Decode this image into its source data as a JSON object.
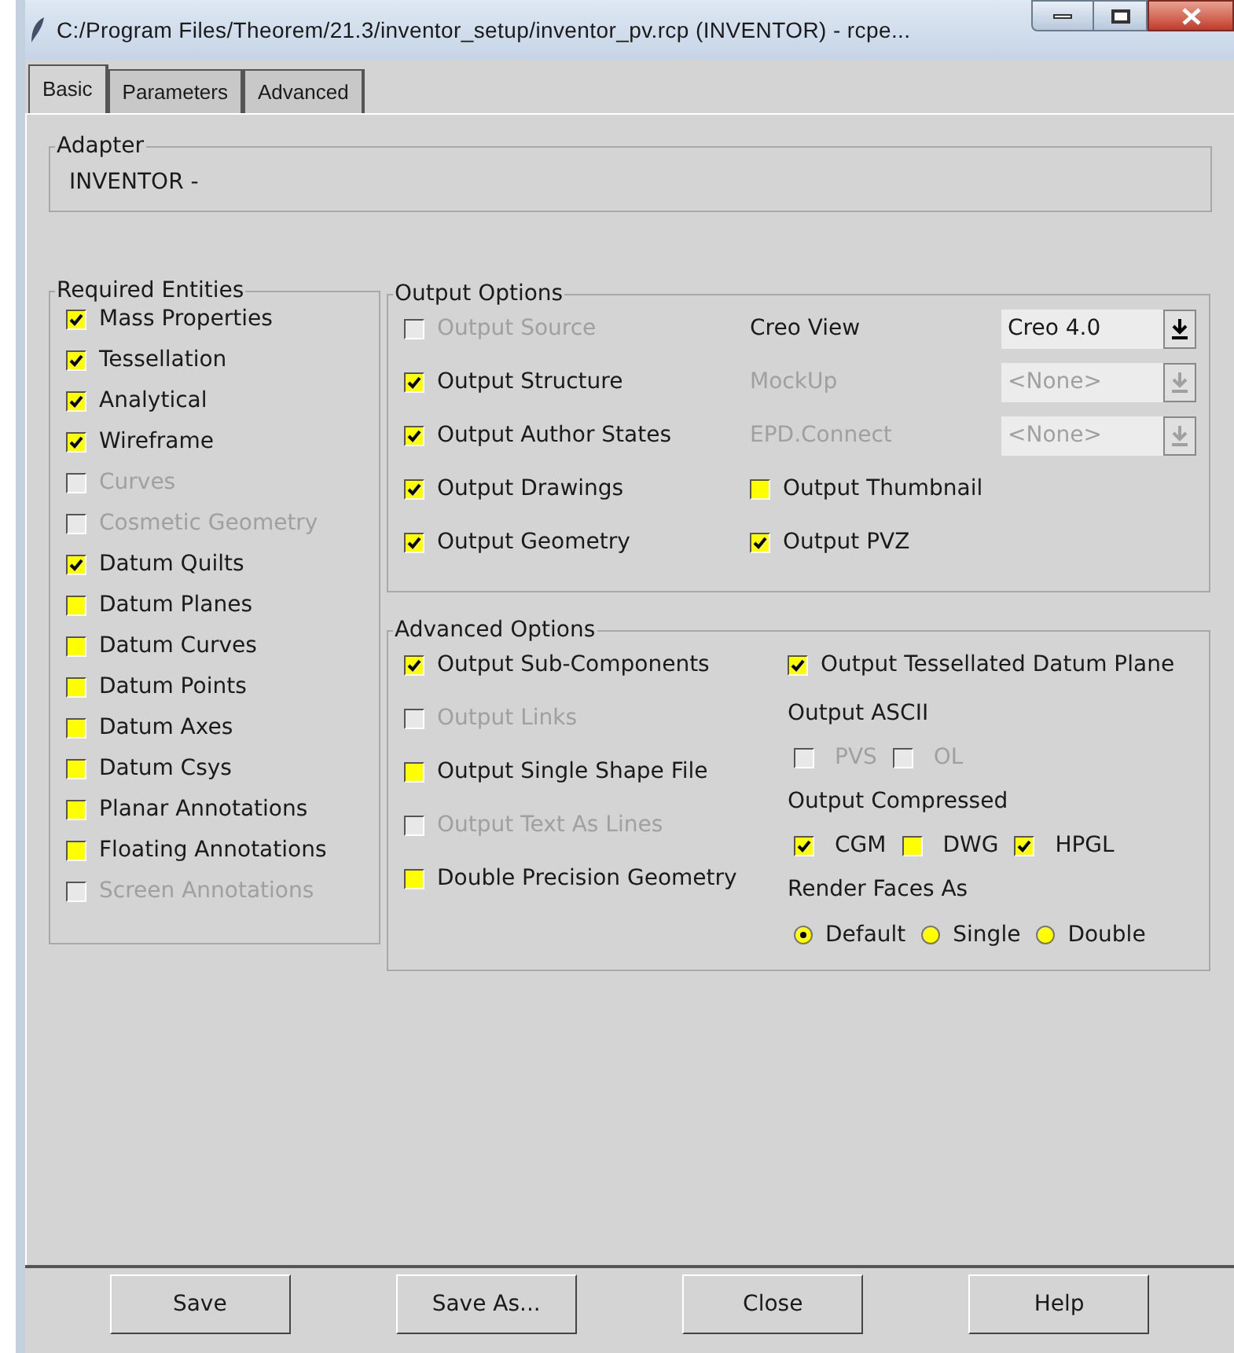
{
  "window": {
    "title": "C:/Program Files/Theorem/21.3/inventor_setup/inventor_pv.rcp (INVENTOR) - rcpe..."
  },
  "tabs": [
    {
      "label": "Basic",
      "selected": true
    },
    {
      "label": "Parameters",
      "selected": false
    },
    {
      "label": "Advanced",
      "selected": false
    }
  ],
  "adapter": {
    "title": "Adapter",
    "value": "INVENTOR -"
  },
  "required_entities": {
    "title": "Required Entities",
    "items": [
      {
        "label": "Mass Properties",
        "checked": true,
        "disabled": false
      },
      {
        "label": "Tessellation",
        "checked": true,
        "disabled": false
      },
      {
        "label": "Analytical",
        "checked": true,
        "disabled": false
      },
      {
        "label": "Wireframe",
        "checked": true,
        "disabled": false
      },
      {
        "label": "Curves",
        "checked": false,
        "disabled": true
      },
      {
        "label": "Cosmetic Geometry",
        "checked": false,
        "disabled": true
      },
      {
        "label": "Datum Quilts",
        "checked": true,
        "disabled": false
      },
      {
        "label": "Datum Planes",
        "checked": false,
        "disabled": false
      },
      {
        "label": "Datum Curves",
        "checked": false,
        "disabled": false
      },
      {
        "label": "Datum Points",
        "checked": false,
        "disabled": false
      },
      {
        "label": "Datum Axes",
        "checked": false,
        "disabled": false
      },
      {
        "label": "Datum Csys",
        "checked": false,
        "disabled": false
      },
      {
        "label": "Planar Annotations",
        "checked": false,
        "disabled": false
      },
      {
        "label": "Floating Annotations",
        "checked": false,
        "disabled": false
      },
      {
        "label": "Screen Annotations",
        "checked": false,
        "disabled": true
      }
    ]
  },
  "output_options": {
    "title": "Output Options",
    "left": [
      {
        "kind": "checkbox",
        "label": "Output Source",
        "checked": false,
        "disabled": true
      },
      {
        "kind": "checkbox",
        "label": "Output Structure",
        "checked": true,
        "disabled": false
      },
      {
        "kind": "checkbox",
        "label": "Output Author States",
        "checked": true,
        "disabled": false
      },
      {
        "kind": "checkbox",
        "label": "Output Drawings",
        "checked": true,
        "disabled": false
      },
      {
        "kind": "checkbox",
        "label": "Output Geometry",
        "checked": true,
        "disabled": false
      }
    ],
    "right": [
      {
        "kind": "dropdown",
        "label": "Creo View",
        "value": "Creo 4.0",
        "disabled": false
      },
      {
        "kind": "dropdown",
        "label": "MockUp",
        "value": "<None>",
        "disabled": true
      },
      {
        "kind": "dropdown",
        "label": "EPD.Connect",
        "value": "<None>",
        "disabled": true
      },
      {
        "kind": "checkbox",
        "label": "Output Thumbnail",
        "checked": false,
        "disabled": false
      },
      {
        "kind": "checkbox",
        "label": "Output PVZ",
        "checked": true,
        "disabled": false
      }
    ]
  },
  "advanced_options": {
    "title": "Advanced Options",
    "left": [
      {
        "kind": "checkbox",
        "label": "Output Sub-Components",
        "checked": true,
        "disabled": false
      },
      {
        "kind": "checkbox",
        "label": "Output Links",
        "checked": false,
        "disabled": true
      },
      {
        "kind": "checkbox",
        "label": "Output Single Shape File",
        "checked": false,
        "disabled": false
      },
      {
        "kind": "checkbox",
        "label": "Output Text As Lines",
        "checked": false,
        "disabled": true
      },
      {
        "kind": "checkbox",
        "label": "Double Precision Geometry",
        "checked": false,
        "disabled": false
      }
    ],
    "right": [
      {
        "kind": "checkbox",
        "label": "Output Tessellated Datum Plane",
        "checked": true,
        "disabled": false
      },
      {
        "kind": "heading",
        "label": "Output ASCII"
      },
      {
        "kind": "checkbox_row",
        "items": [
          {
            "label": "PVS",
            "checked": false,
            "disabled": true
          },
          {
            "label": "OL",
            "checked": false,
            "disabled": true
          }
        ]
      },
      {
        "kind": "heading",
        "label": "Output Compressed"
      },
      {
        "kind": "checkbox_row",
        "items": [
          {
            "label": "CGM",
            "checked": true,
            "disabled": false
          },
          {
            "label": "DWG",
            "checked": false,
            "disabled": false
          },
          {
            "label": "HPGL",
            "checked": true,
            "disabled": false
          }
        ]
      },
      {
        "kind": "heading",
        "label": "Render Faces As"
      },
      {
        "kind": "radio_row",
        "items": [
          {
            "label": "Default",
            "selected": true
          },
          {
            "label": "Single",
            "selected": false
          },
          {
            "label": "Double",
            "selected": false
          }
        ]
      }
    ]
  },
  "buttons": [
    "Save",
    "Save As...",
    "Close",
    "Help"
  ]
}
